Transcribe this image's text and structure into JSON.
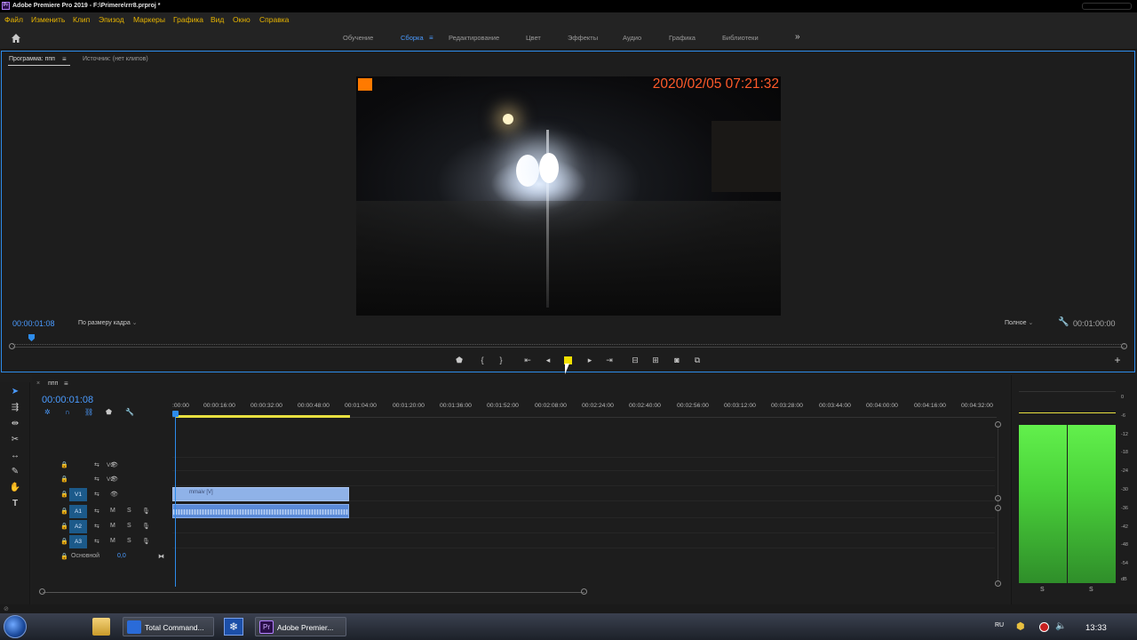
{
  "window": {
    "title": "Adobe Premiere Pro 2019 - F:\\Primere\\rrr8.prproj *"
  },
  "menu": [
    "Файл",
    "Изменить",
    "Клип",
    "Эпизод",
    "Маркеры",
    "Графика",
    "Вид",
    "Окно",
    "Справка"
  ],
  "workspaces": {
    "items": [
      "Обучение",
      "Сборка",
      "Редактирование",
      "Цвет",
      "Эффекты",
      "Аудио",
      "Графика",
      "Библиотеки"
    ],
    "active": "Сборка",
    "more_icon": "double-chevron-right-icon"
  },
  "program_monitor": {
    "tab_program": "Программа: ппп",
    "tab_source": "Источник: (нет клипов)",
    "video_timestamp": "2020/02/05 07:21:32",
    "current_timecode": "00:00:01:08",
    "fit_dropdown": "По размеру кадра",
    "quality_dropdown": "Полное",
    "duration": "00:01:00:00",
    "controls": [
      "marker-icon",
      "mark-in-icon",
      "mark-out-icon",
      "go-to-in-icon",
      "step-back-icon",
      "stop-icon",
      "step-forward-icon",
      "go-to-out-icon",
      "lift-icon",
      "extract-icon",
      "export-frame-icon",
      "compare-icon"
    ],
    "add_button": "+"
  },
  "timeline": {
    "sequence_tab": "ппп",
    "timecode": "00:00:01:08",
    "ruler_labels": [
      ":00:00",
      "00:00:16:00",
      "00:00:32:00",
      "00:00:48:00",
      "00:01:04:00",
      "00:01:20:00",
      "00:01:36:00",
      "00:01:52:00",
      "00:02:08:00",
      "00:02:24:00",
      "00:02:40:00",
      "00:02:56:00",
      "00:03:12:00",
      "00:03:28:00",
      "00:03:44:00",
      "00:04:00:00",
      "00:04:16:00",
      "00:04:32:00"
    ],
    "video_tracks": [
      "V3",
      "V2",
      "V1"
    ],
    "audio_tracks": [
      "A1",
      "A2",
      "A3"
    ],
    "track_mute": "M",
    "track_solo": "S",
    "master_label": "Основной",
    "master_value": "0,0",
    "video_clip_label": "mmaiv [V]"
  },
  "audio_meter": {
    "scale": [
      "0",
      "-6",
      "-12",
      "-18",
      "-24",
      "-30",
      "-36",
      "-42",
      "-48",
      "-54",
      "dB"
    ],
    "solo_l": "S",
    "solo_r": "S"
  },
  "taskbar": {
    "apps": [
      "Total Command...",
      "Adobe Premier..."
    ],
    "lang": "RU",
    "clock": "13:33"
  },
  "colors": {
    "accent": "#2d8ceb",
    "menu_text": "#e8b500",
    "timestamp": "#ff5a2a",
    "stop": "#f2e000",
    "meter": "#4ad23a"
  }
}
